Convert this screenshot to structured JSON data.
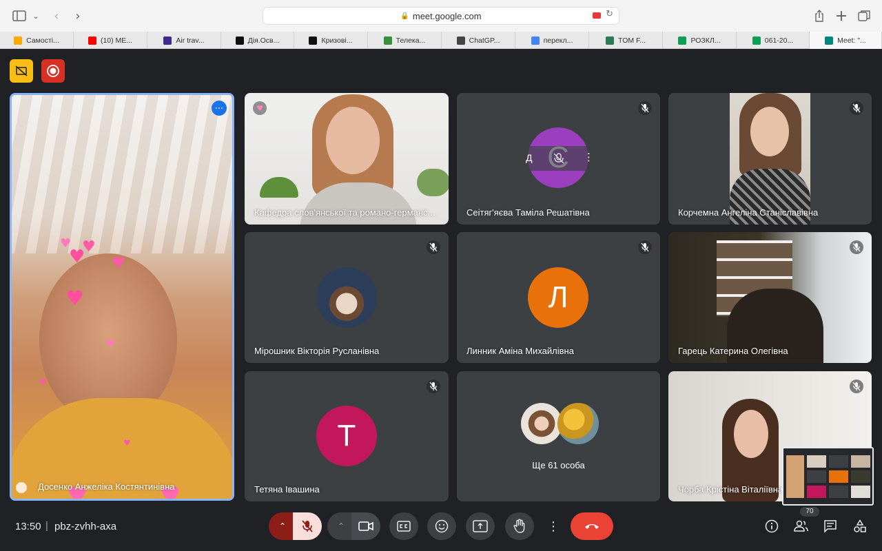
{
  "browser": {
    "url": "meet.google.com",
    "tabs": [
      {
        "label": "Самості...",
        "color": "#f9ab00"
      },
      {
        "label": "(10) ME...",
        "color": "#ff0000"
      },
      {
        "label": "Air trav...",
        "color": "#3f2a8c"
      },
      {
        "label": "Дія.Осв...",
        "color": "#111111"
      },
      {
        "label": "Кризові...",
        "color": "#111111"
      },
      {
        "label": "Телека...",
        "color": "#3a8f3a"
      },
      {
        "label": "ChatGP...",
        "color": "#444444"
      },
      {
        "label": "перекл...",
        "color": "#4285f4"
      },
      {
        "label": "TOM F...",
        "color": "#2b7a55"
      },
      {
        "label": "РОЗКЛ...",
        "color": "#0f9d58"
      },
      {
        "label": "061-20...",
        "color": "#0f9d58"
      },
      {
        "label": "Meet: \"...",
        "color": "#00897b"
      }
    ]
  },
  "participants": [
    {
      "name": "Досенко Анжеліка Костянтинівна"
    },
    {
      "name": "Кафедра слов'янської та романо-германс..."
    },
    {
      "name": "Сеітяг'яєва Таміла Решатівна",
      "initial": "С",
      "pin_label": "Д"
    },
    {
      "name": "Корчемна Ангеліна Станіславівна"
    },
    {
      "name": "Мірошник Вікторія Русланівна"
    },
    {
      "name": "Линник Аміна Михайлівна",
      "initial": "Л"
    },
    {
      "name": "Гарець Катерина Олегівна"
    },
    {
      "name": "Тетяна Івашина",
      "initial": "Т"
    },
    {
      "name": "Чорба Крістіна Віталіївна"
    }
  ],
  "others_label": "Ще 61 особа",
  "meeting": {
    "time": "13:50",
    "separator": "|",
    "code": "pbz-zvhh-axa",
    "people_count": "70"
  }
}
